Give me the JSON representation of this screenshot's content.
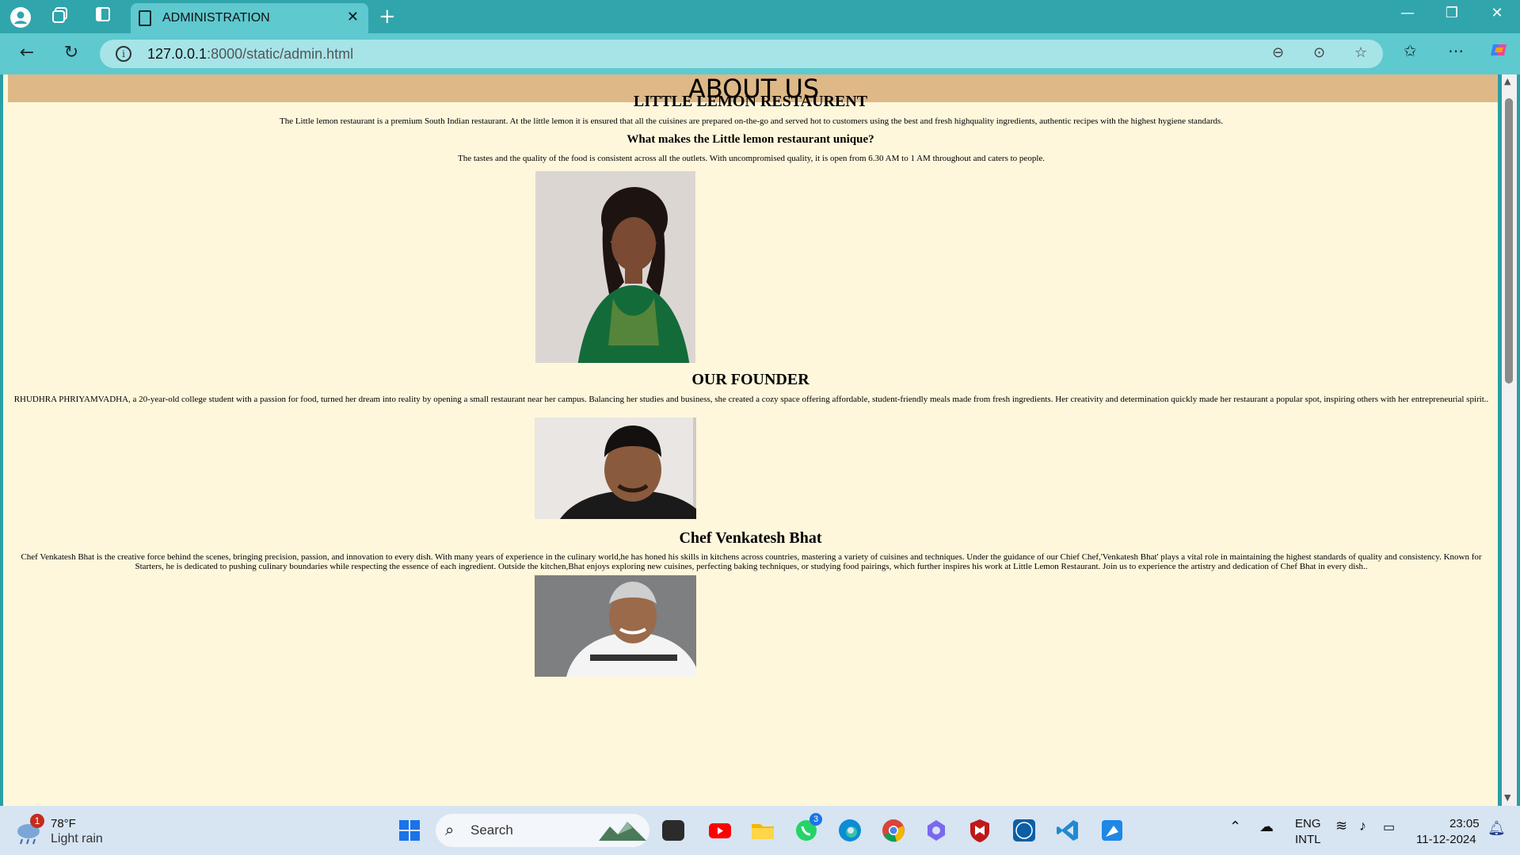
{
  "browser": {
    "tab_title": "ADMINISTRATION",
    "url_host": "127.0.0.1",
    "url_rest": ":8000/static/admin.html"
  },
  "page": {
    "banner": "ABOUT US",
    "restaurant_title": "LITTLE LEMON RESTAURENT",
    "intro": "The Little lemon restaurant is a premium South Indian restaurant. At the little lemon it is ensured that all the cuisines are prepared on-the-go and served hot to customers using the best and fresh highquality ingredients, authentic recipes with the highest hygiene standards.",
    "unique_heading": "What makes the Little lemon restaurant unique?",
    "unique_text": "The tastes and the quality of the food is consistent across all the outlets. With uncompromised quality, it is open from 6.30 AM to 1 AM throughout and caters to people.",
    "founder_heading": "OUR FOUNDER",
    "founder_text": "RHUDHRA PHRIYAMVADHA, a 20-year-old college student with a passion for food, turned her dream into reality by opening a small restaurant near her campus. Balancing her studies and business, she created a cozy space offering affordable, student-friendly meals made from fresh ingredients. Her creativity and determination quickly made her restaurant a popular spot, inspiring others with her entrepreneurial spirit..",
    "chef_heading": "Chef Venkatesh Bhat",
    "chef_text": "Chef Venkatesh Bhat is the creative force behind the scenes, bringing precision, passion, and innovation to every dish. With many years of experience in the culinary world,he has honed his skills in kitchens across countries, mastering a variety of cuisines and techniques. Under the guidance of our Chief Chef,'Venkatesh Bhat' plays a vital role in maintaining the highest standards of quality and consistency. Known for Starters, he is dedicated to pushing culinary boundaries while respecting the essence of each ingredient. Outside the kitchen,Bhat enjoys exploring new cuisines, perfecting baking techniques, or studying food pairings, which further inspires his work at Little Lemon Restaurant. Join us to experience the artistry and dedication of Chef Bhat in every dish.."
  },
  "taskbar": {
    "weather_temp": "78°F",
    "weather_desc": "Light rain",
    "weather_badge": "1",
    "search_placeholder": "Search",
    "whatsapp_badge": "3",
    "lang_top": "ENG",
    "lang_bottom": "INTL",
    "time": "23:05",
    "date": "11-12-2024"
  }
}
